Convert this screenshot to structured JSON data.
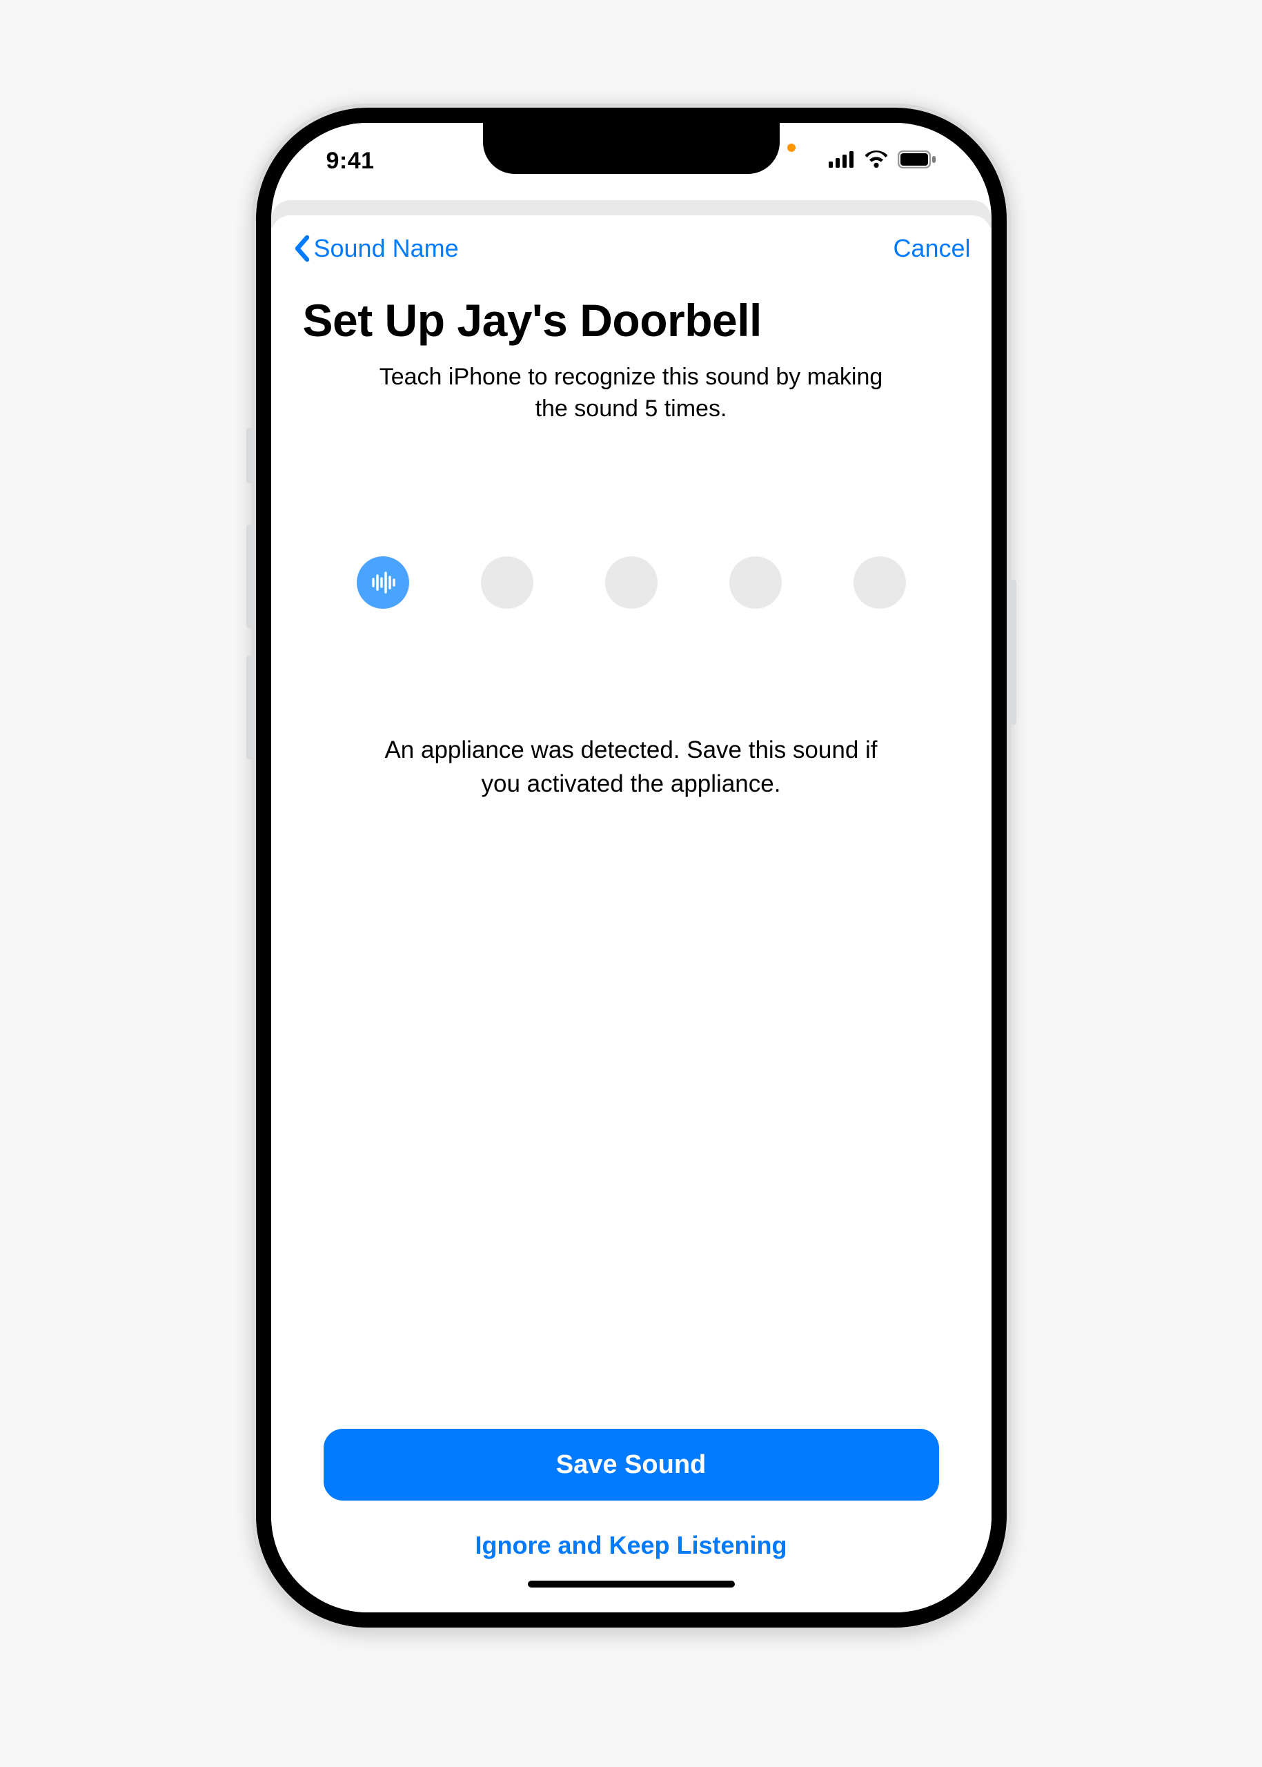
{
  "status": {
    "time": "9:41"
  },
  "nav": {
    "back_label": "Sound Name",
    "cancel_label": "Cancel"
  },
  "headline": "Set Up Jay's Doorbell",
  "instructions": "Teach iPhone to recognize this sound by making the sound 5 times.",
  "progress": {
    "total": 5,
    "completed": 1
  },
  "detection_message": "An appliance was detected. Save this sound if you activated the appliance.",
  "buttons": {
    "primary": "Save Sound",
    "secondary": "Ignore and Keep Listening"
  },
  "colors": {
    "accent": "#007AFF"
  }
}
